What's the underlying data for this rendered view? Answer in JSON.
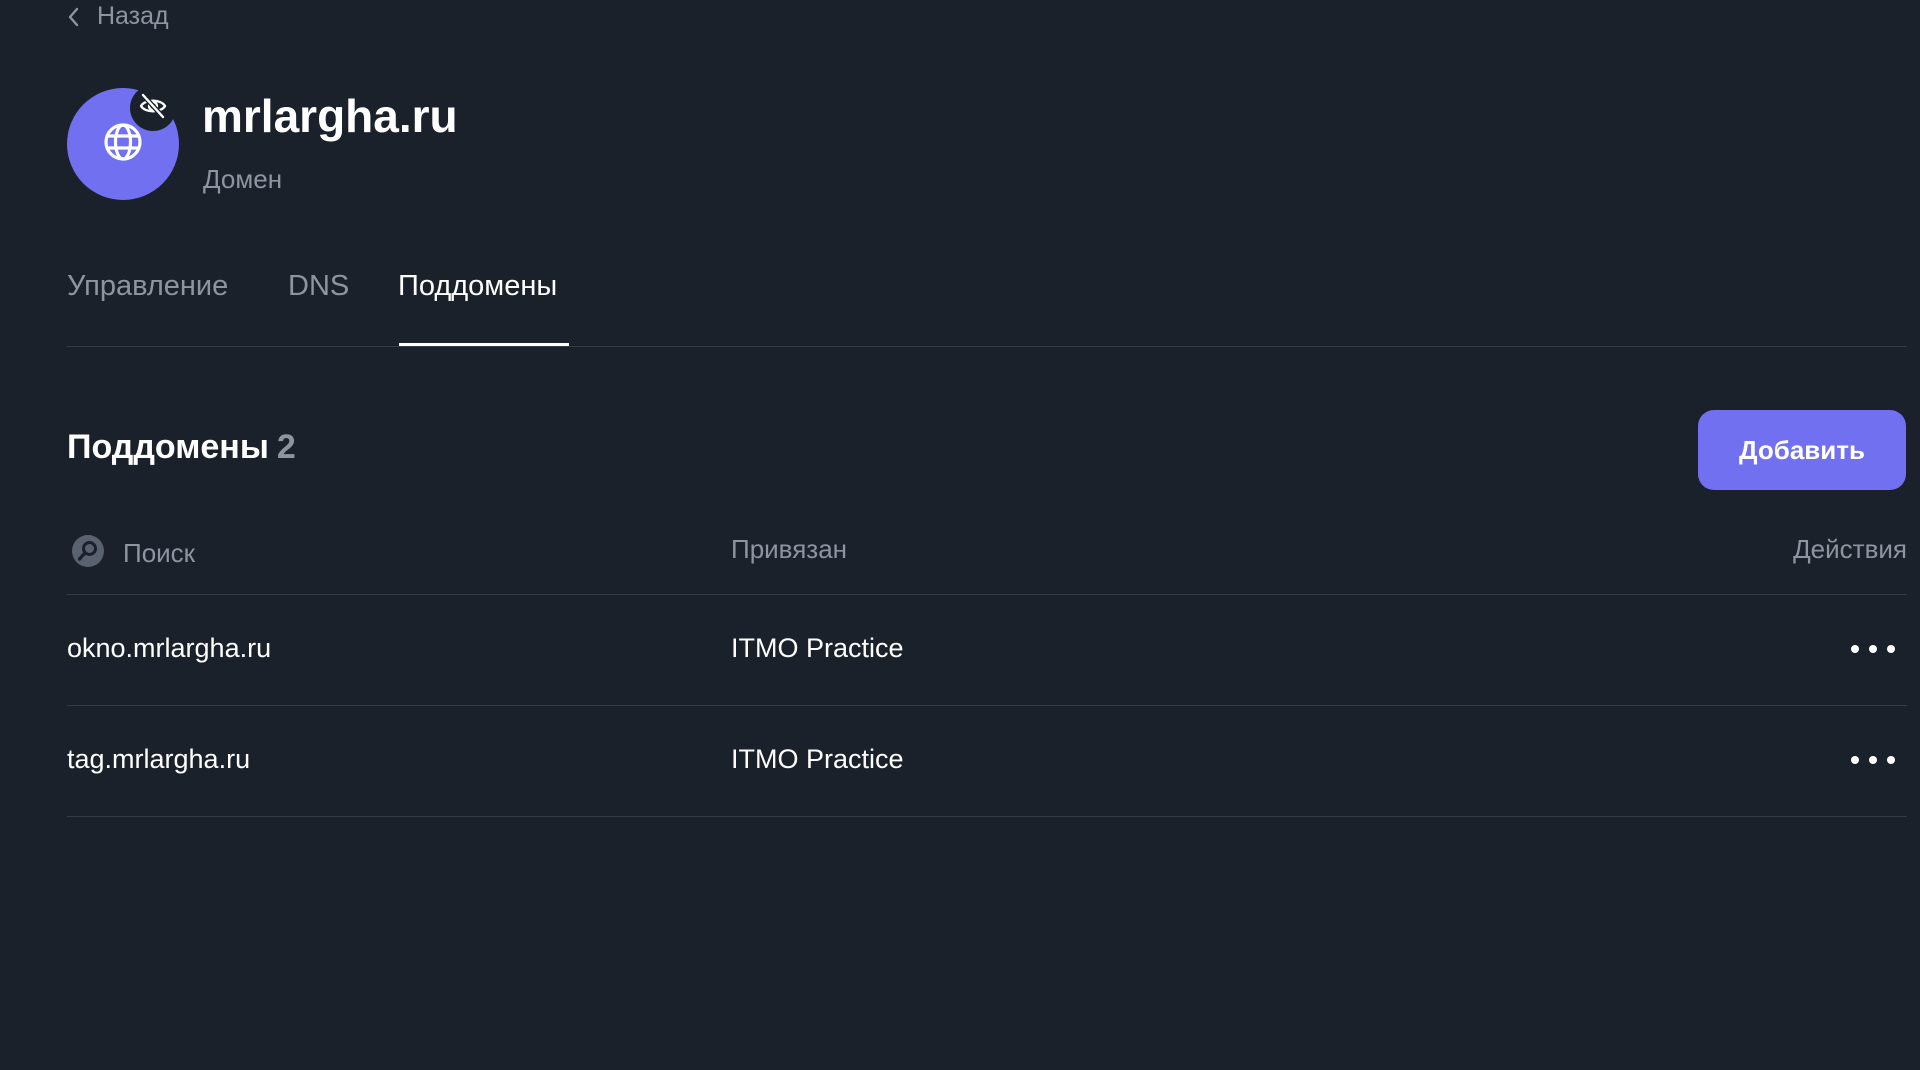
{
  "nav": {
    "back_label": "Назад",
    "back_icon": "chevron-left-icon"
  },
  "header": {
    "title": "mrlargha.ru",
    "subtitle": "Домен",
    "avatar_icon": "globe-icon",
    "badge_icon": "eye-off-icon"
  },
  "tabs": [
    {
      "label": "Управление",
      "active": false
    },
    {
      "label": "DNS",
      "active": false
    },
    {
      "label": "Поддомены",
      "active": true
    }
  ],
  "section": {
    "title": "Поддомены",
    "count": "2",
    "add_label": "Добавить"
  },
  "table": {
    "search_placeholder": "Поиск",
    "search_value": "",
    "search_icon": "search-icon",
    "columns": {
      "bound": "Привязан",
      "actions": "Действия"
    },
    "rows": [
      {
        "name": "okno.mrlargha.ru",
        "bound": "ITMO Practice",
        "actions_icon": "more-horizontal-icon"
      },
      {
        "name": "tag.mrlargha.ru",
        "bound": "ITMO Practice",
        "actions_icon": "more-horizontal-icon"
      }
    ]
  },
  "colors": {
    "background": "#1b212b",
    "accent": "#7070f0",
    "text_primary": "#ffffff",
    "text_secondary": "#8e95a1",
    "divider": "#343b46"
  }
}
